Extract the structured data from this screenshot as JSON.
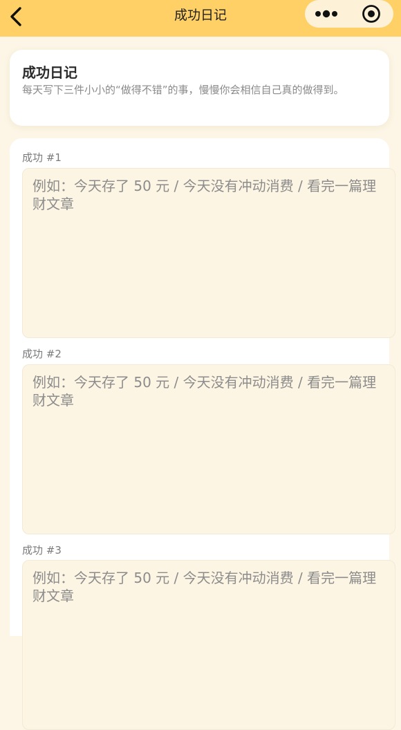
{
  "navbar": {
    "title": "成功日记",
    "back_icon": "chevron-left-icon",
    "more_icon": "more-dots-icon",
    "close_icon": "target-circle-icon"
  },
  "header": {
    "title": "成功日记",
    "description": "每天写下三件小小的“做得不错”的事，慢慢你会相信自己真的做得到。"
  },
  "entries": [
    {
      "label": "成功 #1",
      "placeholder": "例如：今天存了 50 元 / 今天没有冲动消费 / 看完一篇理财文章"
    },
    {
      "label": "成功 #2",
      "placeholder": "例如：今天存了 50 元 / 今天没有冲动消费 / 看完一篇理财文章"
    },
    {
      "label": "成功 #3",
      "placeholder": "例如：今天存了 50 元 / 今天没有冲动消费 / 看完一篇理财文章"
    }
  ],
  "colors": {
    "navbar_bg": "#fed065",
    "page_bg": "#fdf6e6",
    "card_bg": "#ffffff",
    "input_bg": "#fdf5e3",
    "capsule_bg": "#fdf2d8"
  }
}
